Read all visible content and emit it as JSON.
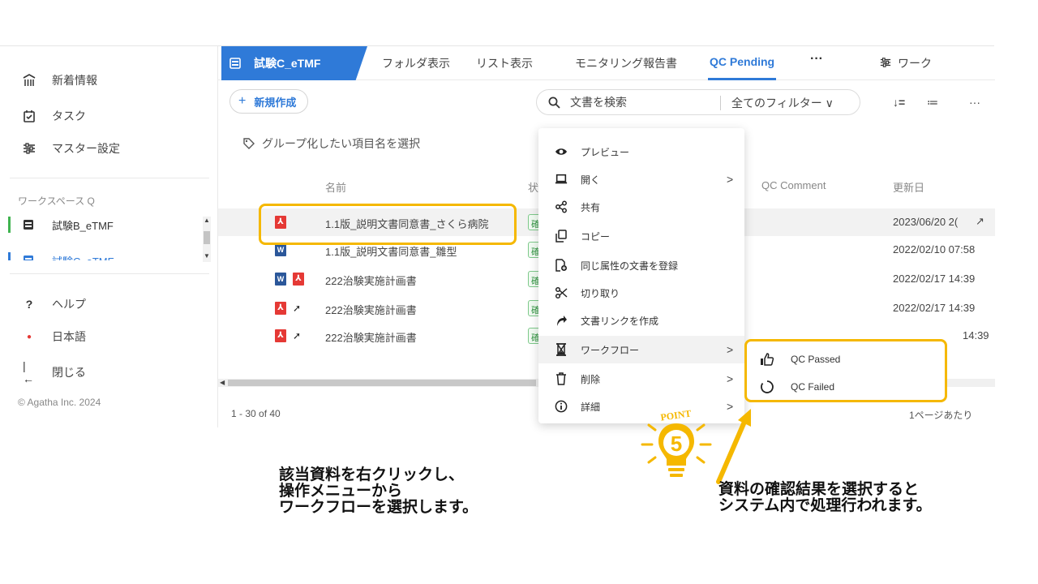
{
  "sidebar": {
    "nav": [
      {
        "label": "新着情報",
        "icon": "news-icon"
      },
      {
        "label": "タスク",
        "icon": "task-icon"
      },
      {
        "label": "マスター設定",
        "icon": "settings-sliders-icon"
      }
    ],
    "workspace_label": "ワークスペース Q",
    "workspaces": [
      {
        "label": "試験B_eTMF",
        "icon": "study-icon"
      },
      {
        "label": "試験C_eTMF",
        "icon": "study-icon"
      }
    ],
    "bottom": [
      {
        "label": "ヘルプ",
        "icon": "help-icon",
        "glyph": "?"
      },
      {
        "label": "日本語",
        "icon": "language-dot-icon",
        "glyph": "●"
      },
      {
        "label": "閉じる",
        "icon": "collapse-icon",
        "glyph": "|←"
      }
    ],
    "copyright": "© Agatha Inc. 2024"
  },
  "tabs": {
    "study": "試験C_eTMF",
    "items": [
      "フォルダ表示",
      "リスト表示",
      "モニタリング報告書",
      "QC Pending"
    ],
    "active": "QC Pending",
    "more": "···",
    "workflow": "ワーク"
  },
  "toolbar": {
    "new_label": "新規作成",
    "search_placeholder": "文書を検索",
    "filter": "全てのフィルター ∨",
    "sort_glyph": "↓=",
    "list_glyph": "≔",
    "more_glyph": "···"
  },
  "group_hint": "グループ化したい項目名を選択",
  "table": {
    "headers": {
      "name": "名前",
      "status": "状態",
      "qc_comment": "QC Comment",
      "updated": "更新日"
    },
    "rows": [
      {
        "icons": [
          "pdf"
        ],
        "name": "1.1版_説明文書同意書_さくら病院",
        "status": "確",
        "date": "2023/06/20 2(",
        "selected": true
      },
      {
        "icons": [
          "word"
        ],
        "name": "1.1版_説明文書同意書_雛型",
        "status": "確",
        "date": "2022/02/10 07:58"
      },
      {
        "icons": [
          "word",
          "pdf"
        ],
        "name": "222治験実施計画書",
        "status": "確",
        "date": "2022/02/17 14:39"
      },
      {
        "icons": [
          "pdf",
          "link"
        ],
        "name": "222治験実施計画書",
        "status": "確",
        "date": "2022/02/17 14:39"
      },
      {
        "icons": [
          "pdf",
          "link"
        ],
        "name": "222治験実施計画書",
        "status": "確",
        "date": "14:39"
      }
    ],
    "pager": "1 - 30 of 40",
    "per_page": "1ページあたり"
  },
  "context_menu": [
    {
      "label": "プレビュー",
      "icon": "eye-icon",
      "glyph": "◉",
      "chevron": false
    },
    {
      "label": "開く",
      "icon": "laptop-icon",
      "glyph": "▭",
      "chevron": true
    },
    {
      "label": "共有",
      "icon": "share-icon",
      "glyph": "⋲",
      "chevron": false
    },
    {
      "label": "コピー",
      "icon": "copy-icon",
      "glyph": "⧉",
      "chevron": false
    },
    {
      "label": "同じ属性の文書を登録",
      "icon": "file-plus-icon",
      "glyph": "⊕",
      "chevron": false
    },
    {
      "label": "切り取り",
      "icon": "scissors-icon",
      "glyph": "✂",
      "chevron": false
    },
    {
      "label": "文書リンクを作成",
      "icon": "link-arrow-icon",
      "glyph": "➚",
      "chevron": false
    },
    {
      "label": "ワークフロー",
      "icon": "hourglass-icon",
      "glyph": "⧗",
      "chevron": true,
      "hover": true
    },
    {
      "label": "削除",
      "icon": "trash-icon",
      "glyph": "🗑",
      "chevron": true
    },
    {
      "label": "詳細",
      "icon": "info-icon",
      "glyph": "ⓘ",
      "chevron": true
    }
  ],
  "submenu": [
    {
      "label": "QC Passed",
      "icon": "thumbs-up-icon"
    },
    {
      "label": "QC Failed",
      "icon": "circle-loading-icon"
    }
  ],
  "captions": {
    "left": [
      "該当資料を右クリックし、",
      "操作メニューから",
      "ワークフローを選択します。"
    ],
    "right": [
      "資料の確認結果を選択すると",
      "システム内で処理行われます。"
    ]
  },
  "point_badge": {
    "text": "POINT",
    "number": "5"
  },
  "colors": {
    "accent": "#2f7ad8",
    "highlight": "#f5b800",
    "workspace_bar": "#3fb34f"
  }
}
